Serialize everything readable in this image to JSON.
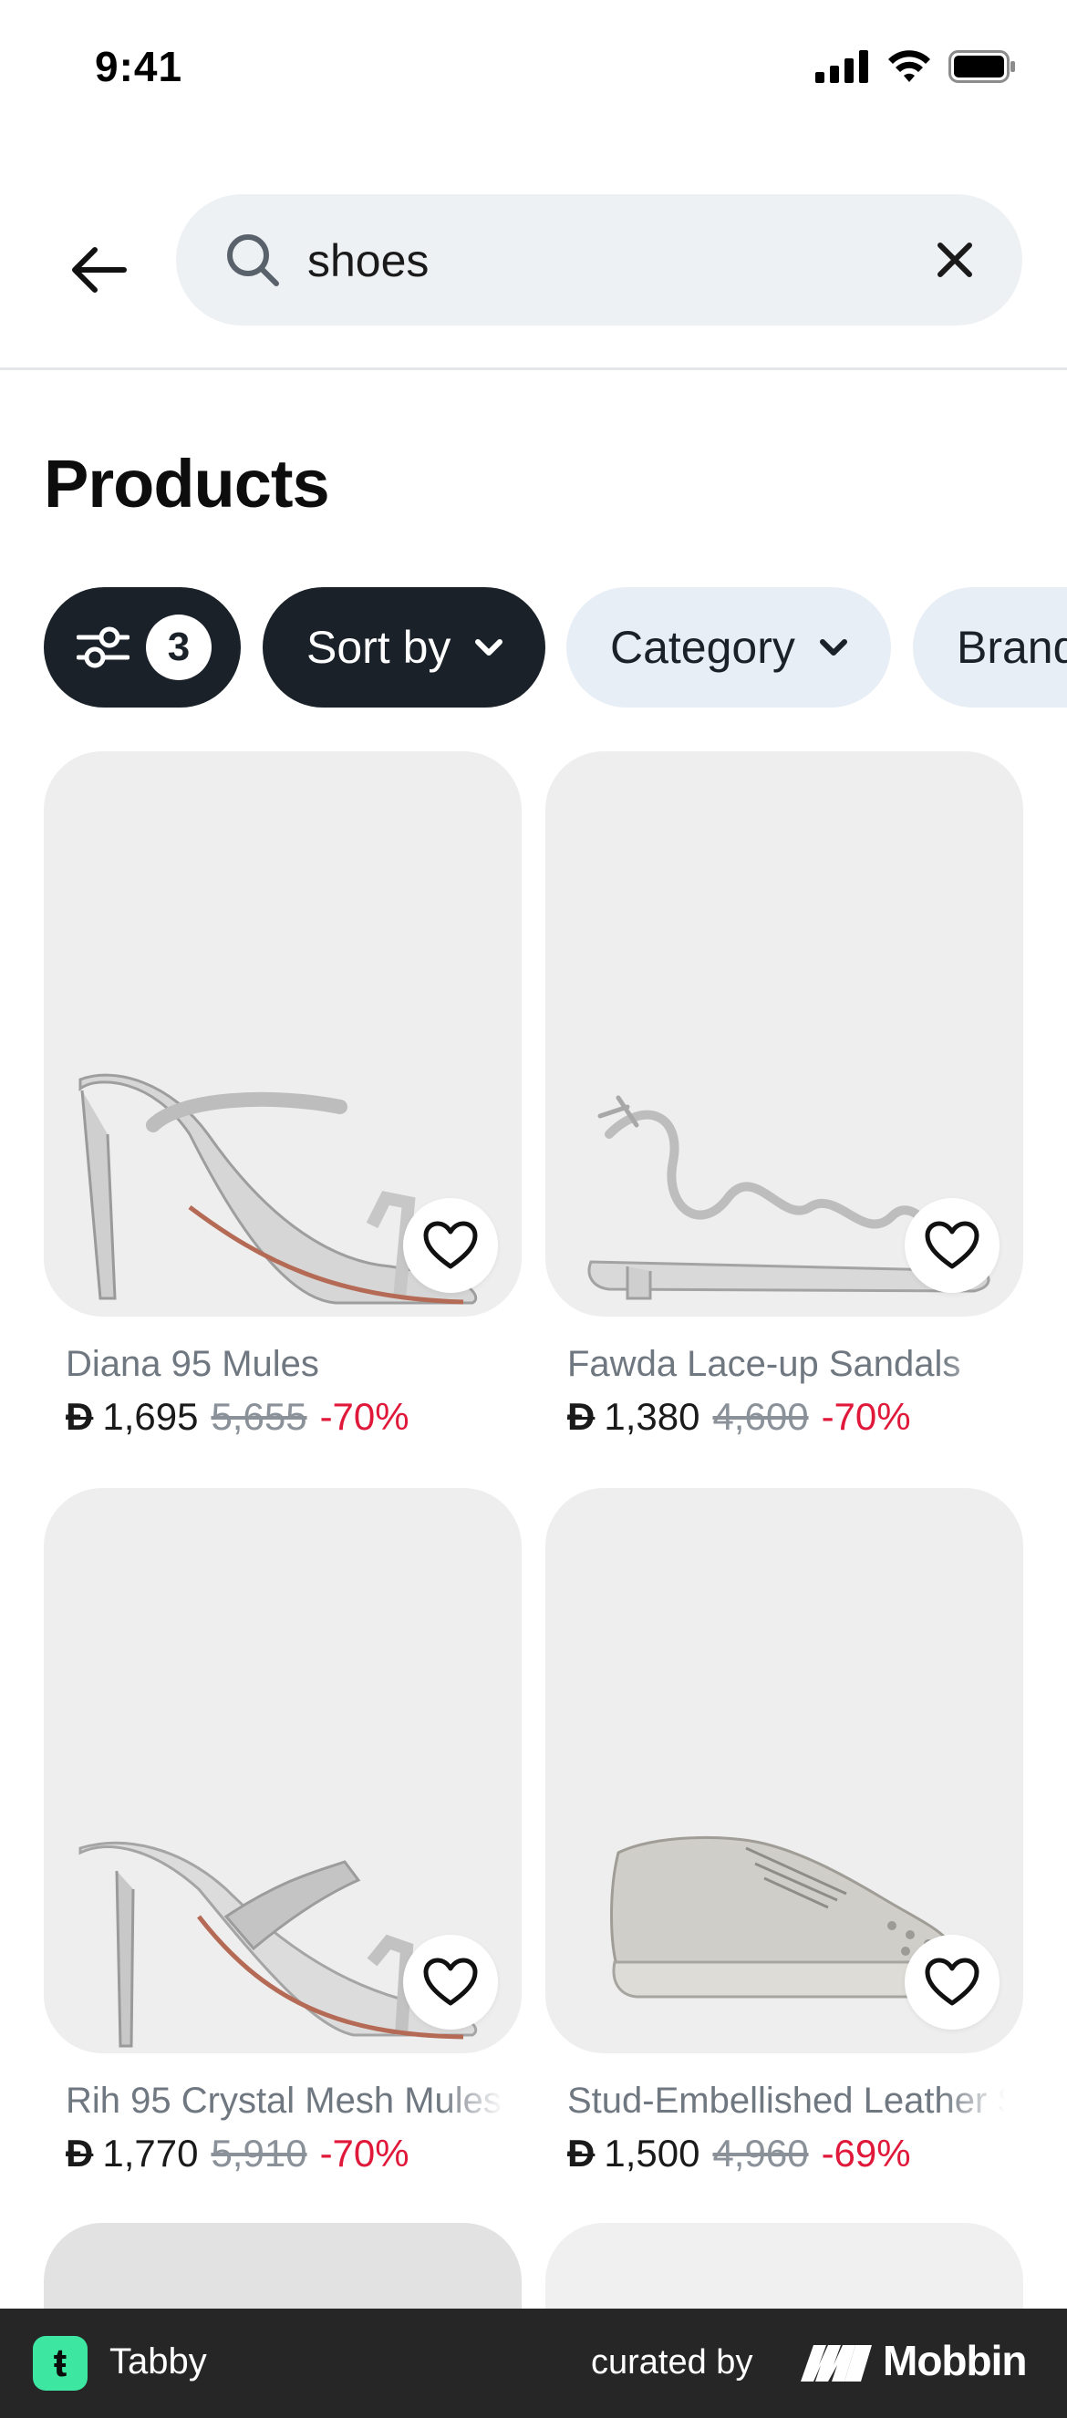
{
  "status_bar": {
    "time": "9:41"
  },
  "search": {
    "query": "shoes"
  },
  "page": {
    "title": "Products"
  },
  "filters": {
    "count": "3",
    "sort_label": "Sort by",
    "category_label": "Category",
    "brand_label": "Brand"
  },
  "products": [
    {
      "name": "Diana 95 Mules",
      "currency": "Đ",
      "price": "1,695",
      "old_price": "5,655",
      "discount": "-70%"
    },
    {
      "name": "Fawda Lace-up Sandals",
      "currency": "Đ",
      "price": "1,380",
      "old_price": "4,600",
      "discount": "-70%"
    },
    {
      "name": "Rih 95 Crystal Mesh Mules",
      "currency": "Đ",
      "price": "1,770",
      "old_price": "5,910",
      "discount": "-70%"
    },
    {
      "name": "Stud-Embellished Leather Sneakers",
      "currency": "Đ",
      "price": "1,500",
      "old_price": "4,960",
      "discount": "-69%"
    }
  ],
  "bottom_bar": {
    "brand": "Tabby",
    "brand_glyph": "ŧ",
    "curated_label": "curated by",
    "mobbin": "Mobbin"
  },
  "colors": {
    "accent_dark": "#1a2129",
    "chip_light": "#e8eef5",
    "discount_red": "#e0193b",
    "tabby_green": "#3de7a2"
  }
}
